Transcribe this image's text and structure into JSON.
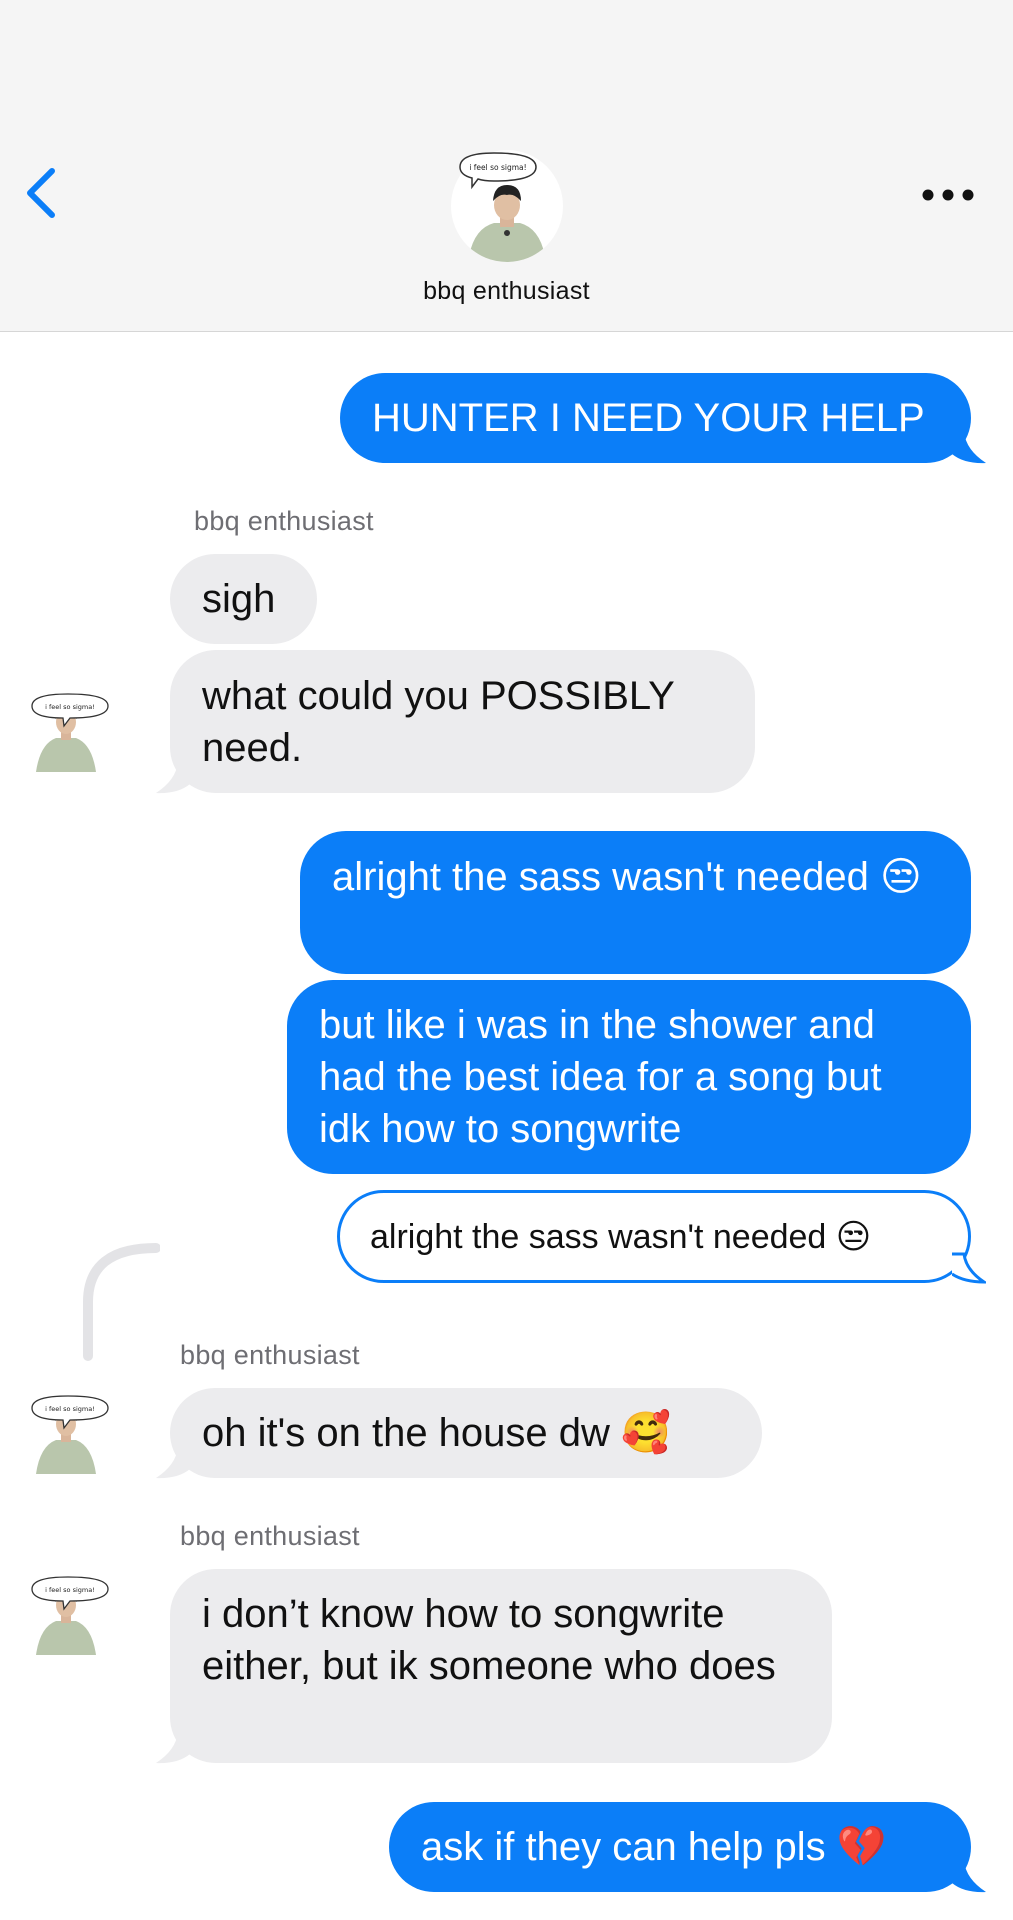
{
  "header": {
    "contact_name": "bbq enthusiast",
    "avatar_caption": "i feel so sigma!",
    "back_icon": "chevron-left-icon",
    "more_icon": "ellipsis-icon",
    "accent_color": "#0b7ef8"
  },
  "messages": [
    {
      "direction": "outgoing",
      "text": "HUNTER I NEED YOUR HELP"
    },
    {
      "direction": "incoming",
      "sender": "bbq enthusiast",
      "text": "sigh"
    },
    {
      "direction": "incoming",
      "text": "what could you POSSIBLY need."
    },
    {
      "direction": "outgoing",
      "text": "alright the sass wasn't needed 😒"
    },
    {
      "direction": "outgoing",
      "text": "but like i was in the shower and had the best idea for a song but idk how to songwrite"
    },
    {
      "direction": "outgoing",
      "type": "quoted",
      "text": "alright the sass wasn't needed 😒"
    },
    {
      "direction": "incoming",
      "sender": "bbq enthusiast",
      "text": "oh it's on the house dw 🥰"
    },
    {
      "direction": "incoming",
      "sender": "bbq enthusiast",
      "text": "i don’t know how to songwrite either, but ik someone who does"
    },
    {
      "direction": "outgoing",
      "text": "ask if they can help pls 💔"
    }
  ]
}
